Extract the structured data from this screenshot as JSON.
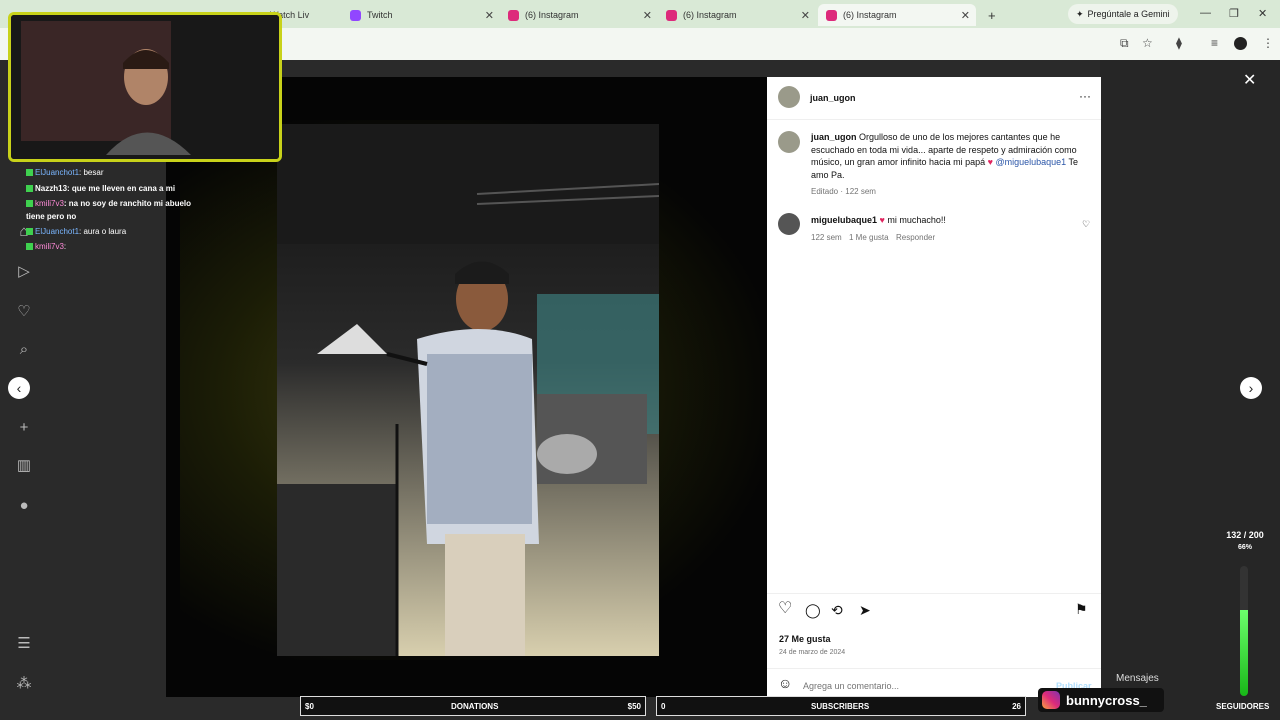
{
  "browser": {
    "tabs": [
      {
        "label": "Twitch",
        "icon": "twitch-icon"
      },
      {
        "label": "(6) Instagram",
        "icon": "instagram-icon"
      },
      {
        "label": "(6) Instagram",
        "icon": "instagram-icon"
      },
      {
        "label": "(6) Instagram",
        "icon": "instagram-icon"
      }
    ],
    "partial_tab": "Watch Liv",
    "new_tab": "+",
    "gemini": "Pregúntale a Gemini"
  },
  "post": {
    "author": "juan_ugon",
    "more": "···",
    "caption_author": "juan_ugon",
    "caption": "Orgulloso de uno de los mejores cantantes que he escuchado en toda mi vida... aparte de respeto y admiración como músico, un gran amor infinito hacia mi papá",
    "mention": "@miguelubaque1",
    "caption_end": "Te amo Pa.",
    "edited": "Editado · 122 sem",
    "comment": {
      "author": "miguelubaque1",
      "text": "mi muchacho!!",
      "age": "122 sem",
      "likes": "1 Me gusta",
      "reply": "Responder"
    },
    "likes": "27 Me gusta",
    "date": "24 de marzo de 2024",
    "comment_placeholder": "Agrega un comentario...",
    "publish": "Publicar"
  },
  "stream": {
    "chat": [
      {
        "nick": "ElJuanchot1",
        "msg": ": besar"
      },
      {
        "nick": "Nazzh13",
        "msg": ": que me lleven en cana a mi"
      },
      {
        "nick": "kmili7v3",
        "msg": ": na no soy de ranchito mi abuelo"
      },
      {
        "nick": "",
        "msg": "tiene pero no"
      },
      {
        "nick": "ElJuanchot1",
        "msg": ": aura o laura"
      },
      {
        "nick": "kmili7v3",
        "msg": ":"
      }
    ],
    "sub_goal": "132 / 200",
    "sub_goal_pct": "66%",
    "sub_goal_fraction": 0.66,
    "donations_left": "$0",
    "donations_label": "DONATIONS",
    "donations_right": "$50",
    "subs_left": "0",
    "subs_label": "SUBSCRIBERS",
    "subs_right": "26",
    "instagram_handle": "bunnycross_",
    "mensajes": "Mensajes",
    "seguidores": "SEGUIDORES"
  },
  "colors": {
    "accent": "#c8d21a",
    "heart": "#e0245e",
    "link": "#2b56a8"
  }
}
